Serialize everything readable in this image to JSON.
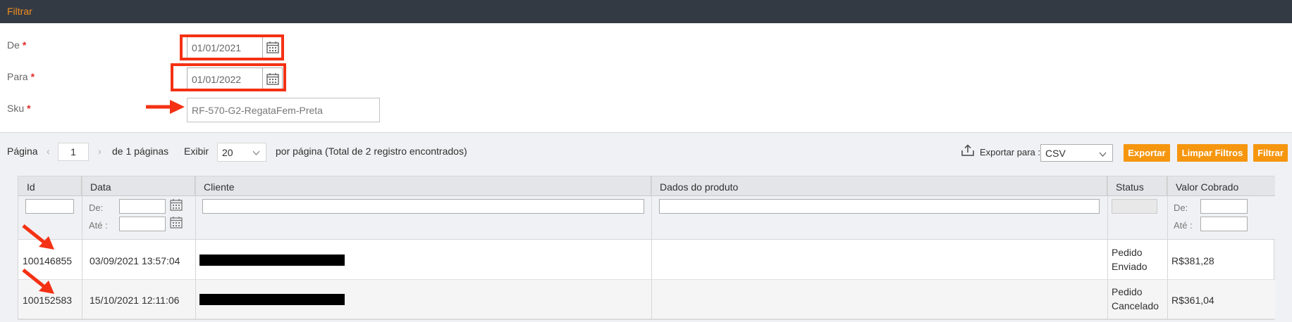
{
  "topbar": {
    "title": "Filtrar"
  },
  "filters": {
    "from": {
      "label": "De",
      "required": "*",
      "value": "01/01/2021"
    },
    "to": {
      "label": "Para",
      "required": "*",
      "value": "01/01/2022"
    },
    "sku": {
      "label": "Sku",
      "required": "*",
      "value": "RF-570-G2-RegataFem-Preta"
    }
  },
  "pagination": {
    "page_label": "Página",
    "current_page": "1",
    "of_pages": "de 1 páginas",
    "show_label": "Exibir",
    "per_page": "20",
    "per_page_text": "por página (Total de 2 registro encontrados)"
  },
  "export": {
    "label": "Exportar para :",
    "format": "CSV",
    "export_button": "Exportar",
    "clear_button": "Limpar Filtros",
    "filter_button": "Filtrar"
  },
  "table": {
    "columns": [
      "Id",
      "Data",
      "Cliente",
      "Dados do produto",
      "Status",
      "Valor Cobrado"
    ],
    "filter_labels": {
      "from": "De:",
      "to": "Até :"
    },
    "rows": [
      {
        "id": "100146855",
        "date": "03/09/2021 13:57:04",
        "status_line1": "Pedido",
        "status_line2": "Enviado",
        "value": "R$381,28"
      },
      {
        "id": "100152583",
        "date": "15/10/2021 12:11:06",
        "status_line1": "Pedido",
        "status_line2": "Cancelado",
        "value": "R$361,04"
      }
    ]
  },
  "colors": {
    "accent": "#f6960f",
    "annotation": "#f43114",
    "topbar": "#343a44"
  },
  "icons": [
    "calendar-icon",
    "upload-icon",
    "chevron-down-icon",
    "arrow-annotation"
  ]
}
